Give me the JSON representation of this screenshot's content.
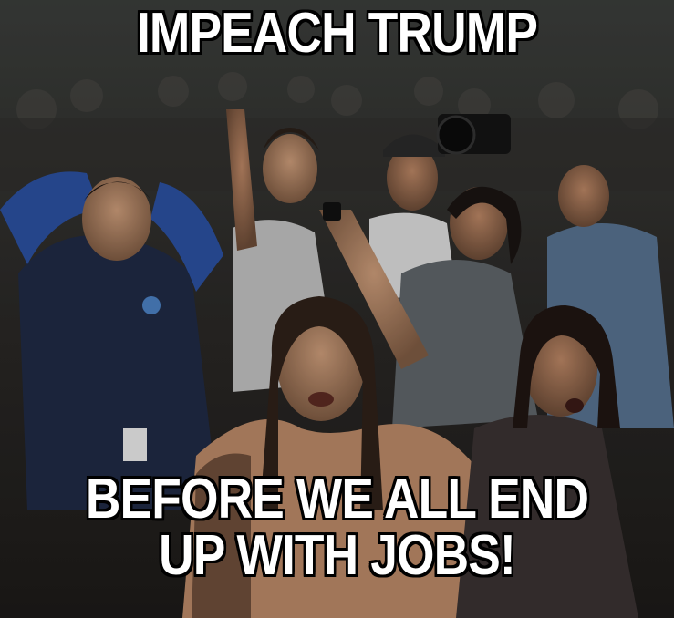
{
  "meme": {
    "top_text": "IMPEACH TRUMP",
    "bottom_text_lines": [
      "BEFORE WE ALL END",
      "UP WITH JOBS!"
    ]
  }
}
